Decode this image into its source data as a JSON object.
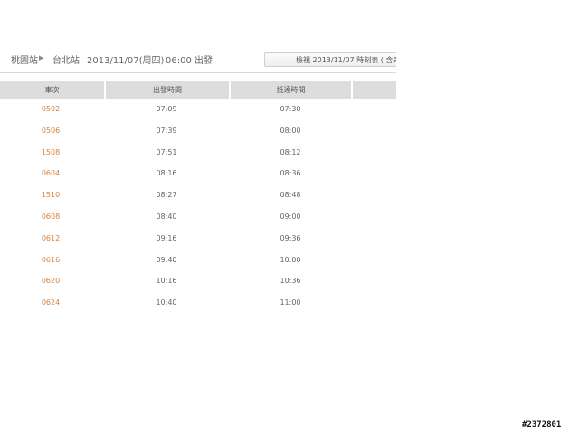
{
  "route": {
    "from_station": "桃園站",
    "arrow": "▶",
    "to_station": "台北站",
    "date": "2013/11/07(周四)",
    "time_text": "06:00 出發",
    "more_button": "檢視 2013/11/07 時刻表 ( 含完"
  },
  "table": {
    "headers": [
      "車次",
      "出發時間",
      "抵達時間",
      ""
    ],
    "rows": [
      {
        "train": "0502",
        "depart": "07:09",
        "arrive": "07:30"
      },
      {
        "train": "0506",
        "depart": "07:39",
        "arrive": "08:00"
      },
      {
        "train": "1508",
        "depart": "07:51",
        "arrive": "08:12"
      },
      {
        "train": "0604",
        "depart": "08:16",
        "arrive": "08:36"
      },
      {
        "train": "1510",
        "depart": "08:27",
        "arrive": "08:48"
      },
      {
        "train": "0608",
        "depart": "08:40",
        "arrive": "09:00"
      },
      {
        "train": "0612",
        "depart": "09:16",
        "arrive": "09:36"
      },
      {
        "train": "0616",
        "depart": "09:40",
        "arrive": "10:00"
      },
      {
        "train": "0620",
        "depart": "10:16",
        "arrive": "10:36"
      },
      {
        "train": "0624",
        "depart": "10:40",
        "arrive": "11:00"
      }
    ]
  },
  "watermark": "#2372801",
  "colors": {
    "train_number": "#d9813a",
    "header_bg": "#dddddd",
    "text": "#666666"
  }
}
